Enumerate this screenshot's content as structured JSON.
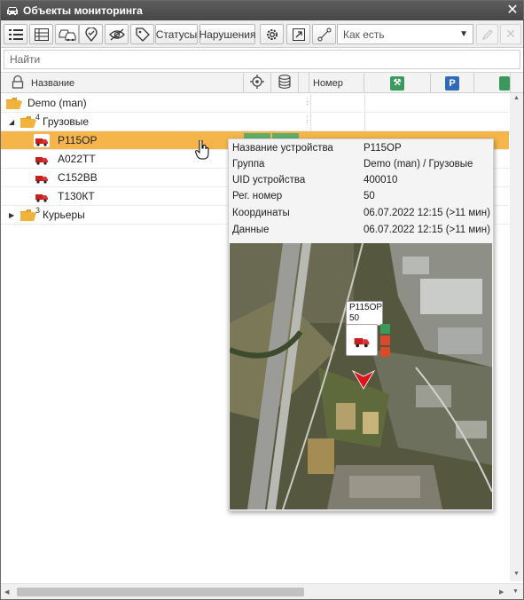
{
  "window": {
    "title": "Объекты мониторинга"
  },
  "toolbar": {
    "statuses_label": "Статусы",
    "violations_label": "Нарушения",
    "filter_combo": "Как есть"
  },
  "search": {
    "placeholder": "Найти"
  },
  "header": {
    "name_label": "Название",
    "number_label": "Номер"
  },
  "tree": {
    "group_demo": "Demo (man)",
    "group_trucks": "Грузовые",
    "group_trucks_count": "4",
    "units": [
      "Р115ОР",
      "А022ТТ",
      "С152ВВ",
      "Т130КТ"
    ],
    "group_couriers": "Курьеры",
    "group_couriers_count": "3"
  },
  "tooltip": {
    "rows": [
      {
        "key": "Название устройства",
        "value": "Р115ОР"
      },
      {
        "key": "Группа",
        "value": "Demo (man) / Грузовые"
      },
      {
        "key": "UID устройства",
        "value": "400010"
      },
      {
        "key": "Рег. номер",
        "value": "50"
      },
      {
        "key": "Координаты",
        "value": "06.07.2022 12:15 (>11 мин)"
      },
      {
        "key": "Данные",
        "value": "06.07.2022 12:15 (>11 мин)"
      }
    ],
    "map_label_line1": "Р115ОР",
    "map_label_line2": "50"
  },
  "colors": {
    "selected_row": "#f6b54a",
    "title_bar": "#4f4f4f",
    "folder": "#f2b33d",
    "green_icon": "#3a9a5c",
    "blue_icon": "#2f6bb8",
    "map_arrow": "#e0141b"
  },
  "icons": {
    "title": "car-icon",
    "close": "close-icon",
    "toolbar": [
      "list-icon",
      "table-icon",
      "vehicles-icon",
      "geofence-icon",
      "hide-icon",
      "tag-icon",
      "settings-icon",
      "export-icon",
      "route-icon",
      "edit-icon",
      "delete-icon"
    ],
    "header": [
      "lock-icon",
      "target-icon",
      "database-icon",
      "engine-icon",
      "parking-icon"
    ]
  }
}
